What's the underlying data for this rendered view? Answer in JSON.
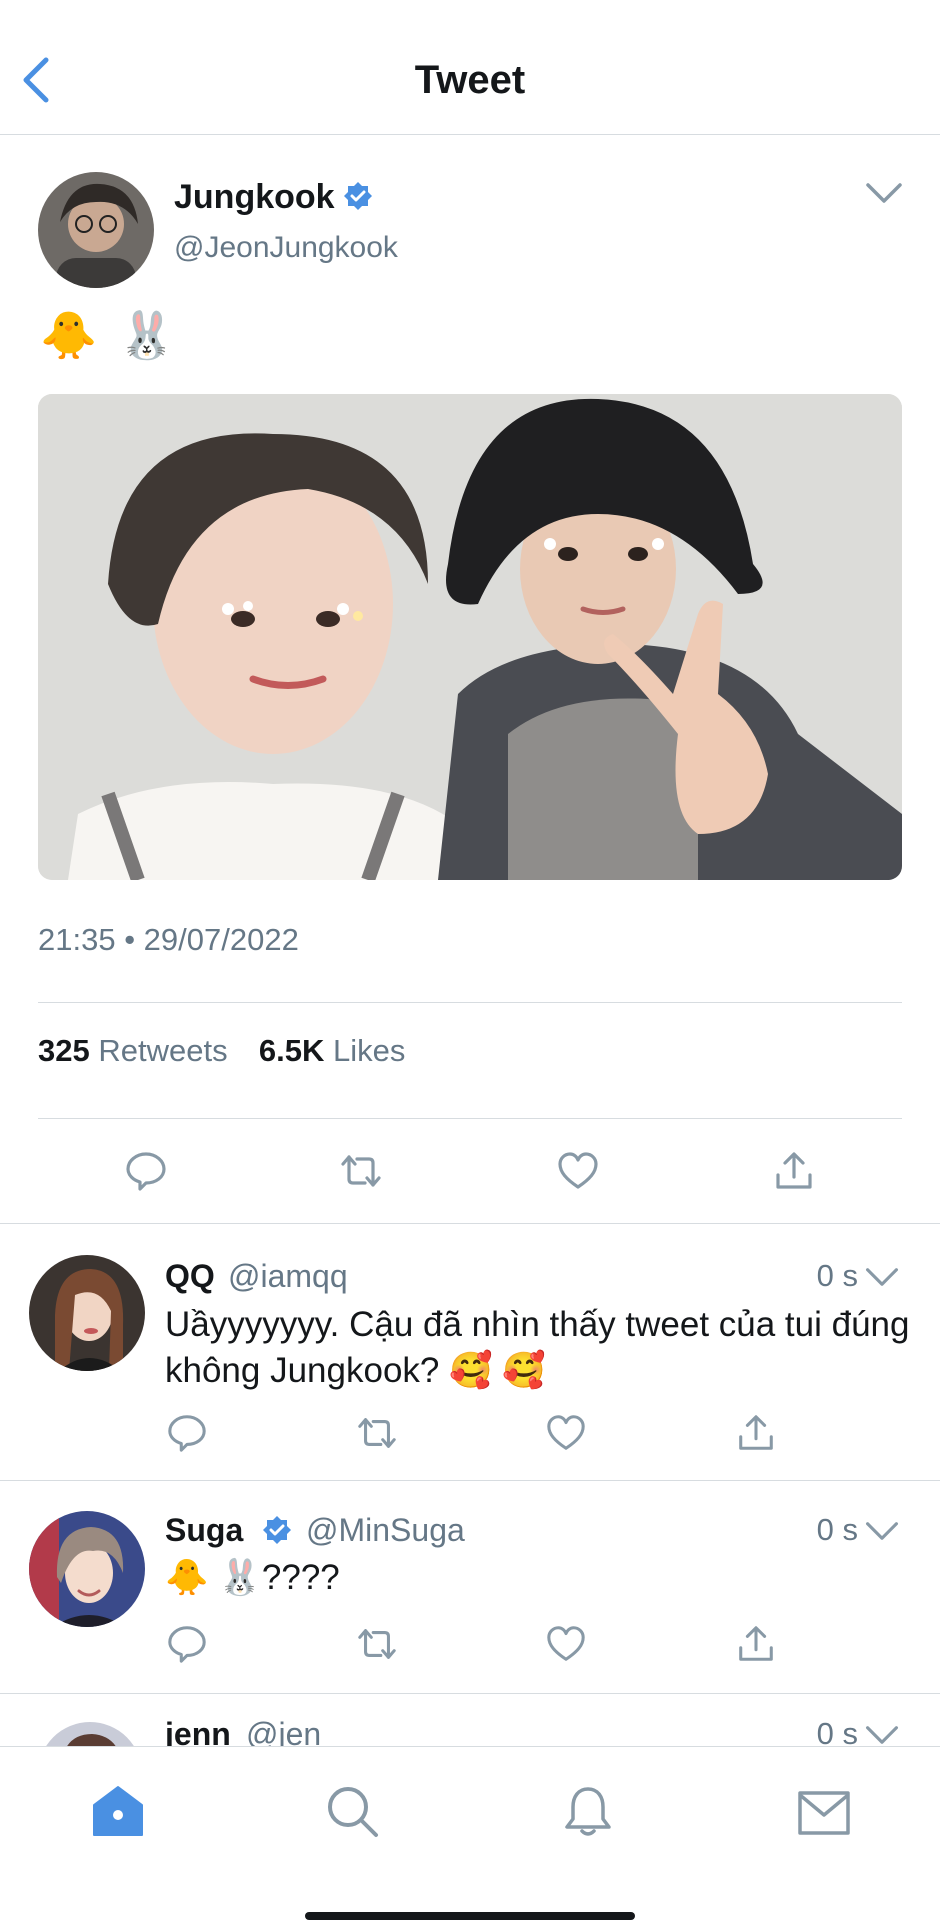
{
  "header": {
    "title": "Tweet"
  },
  "tweet": {
    "author_name": "Jungkook",
    "author_handle": "@JeonJungkook",
    "verified": true,
    "text_emojis": [
      "🐥",
      "🐰"
    ],
    "timestamp": "21:35 • 29/07/2022",
    "retweets_count": "325",
    "retweets_label": "Retweets",
    "likes_count": "6.5K",
    "likes_label": "Likes",
    "icons": [
      "reply-icon",
      "retweet-icon",
      "like-icon",
      "share-icon"
    ]
  },
  "replies": [
    {
      "name": "QQ",
      "handle": "@iamqq",
      "time": "0 s",
      "text": "Uầyyyyyyy. Cậu đã nhìn thấy tweet của tui đúng không Jungkook? 🥰 🥰"
    },
    {
      "name": "Suga",
      "handle": "@MinSuga",
      "verified": true,
      "time": "0 s",
      "text": "🐥 🐰????"
    },
    {
      "name": "jenn",
      "handle": "@jen",
      "time": "0 s"
    }
  ],
  "tabbar": {
    "items": [
      "home-icon",
      "search-icon",
      "notifications-icon",
      "messages-icon"
    ],
    "active": "home-icon"
  },
  "colors": {
    "accent": "#4a90e2",
    "text": "#14171a",
    "secondary": "#657786",
    "divider": "#d7dce0",
    "icon": "#8899a6"
  }
}
